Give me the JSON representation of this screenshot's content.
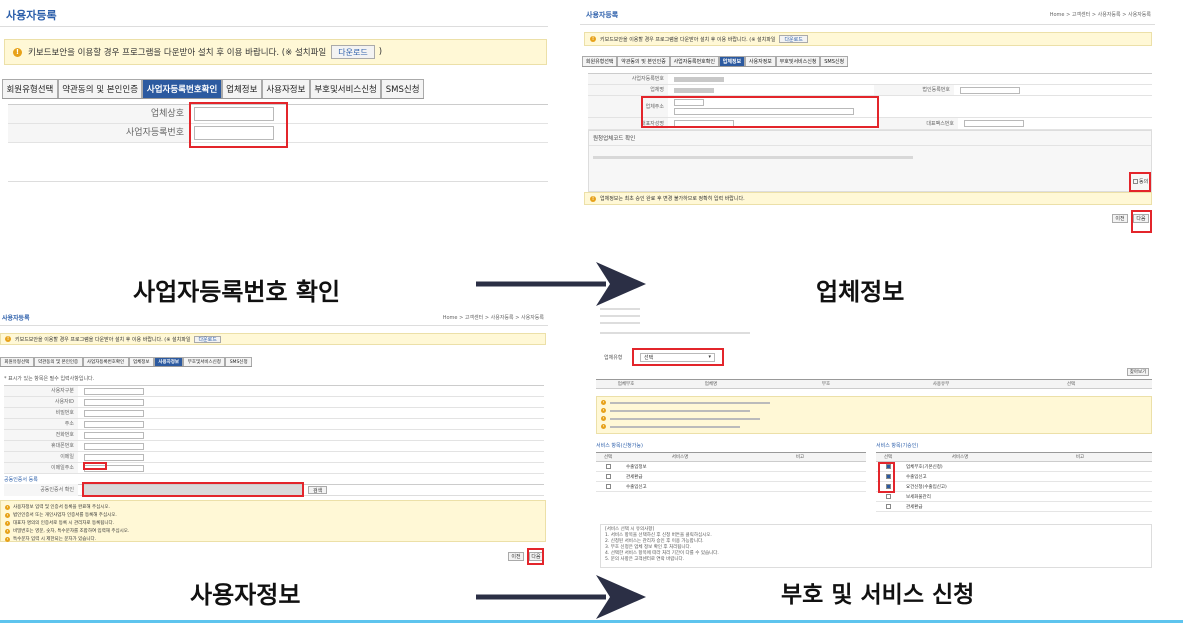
{
  "panel1": {
    "title": "사용자등록",
    "notice_text": "키보드보안을 이용할 경우 프로그램을 다운받아 설치 후 이용 바랍니다. (※ 설치파일",
    "download_label": "다운로드",
    "notice_close": ")",
    "tabs": [
      "회원유형선택",
      "약관동의 및 본인인증",
      "사업자등록번호확인",
      "업체정보",
      "사용자정보",
      "부호및서비스신청",
      "SMS신청"
    ],
    "active_tab": 2,
    "fields": [
      "업체상호",
      "사업자등록번호"
    ]
  },
  "panel2": {
    "title": "사용자등록",
    "breadcrumb": "Home > 고객센터 > 사용자등록 > 사용자등록",
    "notice_text": "키보드보안을 이용할 경우 프로그램을 다운받아 설치 후 이용 바랍니다. (※ 설치파일",
    "download_label": "다운로드",
    "tabs": [
      "회원유형선택",
      "약관동의 및 본인인증",
      "사업자등록번호확인",
      "업체정보",
      "사용자정보",
      "부호및서비스신청",
      "SMS신청"
    ],
    "active_tab": 3,
    "section_label": "원청업체코드 확인",
    "left_labels": [
      "사업자등록번호",
      "업체명",
      "업체주소",
      "대표자성명"
    ],
    "right_labels": [
      "법인등록번호",
      "대표팩스번호"
    ],
    "agree_label": "동의",
    "footer_notice": "업체정보는 최초 승인 완료 후 변경 불가하므로 정확히 입력 바랍니다.",
    "prev_label": "이전",
    "next_label": "다음"
  },
  "panel3": {
    "title": "사용자등록",
    "breadcrumb": "Home > 고객센터 > 사용자등록 > 사용자등록",
    "notice_text": "키보드보안을 이용할 경우 프로그램을 다운받아 설치 후 이용 바랍니다. (※ 설치파일",
    "download_label": "다운로드",
    "tabs": [
      "회원유형선택",
      "약관동의 및 본인인증",
      "사업자등록번호확인",
      "업체정보",
      "사용자정보",
      "부호및서비스신청",
      "SMS신청"
    ],
    "active_tab": 4,
    "required_note": "* 표시가 있는 항목은 필수 입력사항입니다.",
    "labels": [
      "사용자구분",
      "사용자ID",
      "비밀번호",
      "주소",
      "전화번호",
      "휴대폰번호",
      "이메일",
      "이메일주소"
    ],
    "cert_title": "공동인증서 등록",
    "cert_label": "공동인증서 확인",
    "search_label": "검색",
    "prev_label": "이전",
    "next_label": "다음",
    "notes": [
      "사용자정보 입력 및 인증서 등록을 완료해 주십시오.",
      "법인인증서 또는 개인사업자 인증서를 등록해 주십시오.",
      "대표자 명의의 인증서로 등록 시 관리자로 등록됩니다.",
      "비밀번호는 영문, 숫자, 특수문자를 조합하여 입력해 주십시오.",
      "특수문자 입력 시 제한되는 문자가 있습니다."
    ]
  },
  "panel4": {
    "trade_label": "업체유형",
    "trade_value": "선택",
    "search_btn": "찾아보기",
    "table_headers": [
      "업체부호",
      "업체명",
      "부호",
      "사용유무",
      "선택"
    ],
    "service_left_title": "서비스 항목(신청가능)",
    "service_right_title": "서비스 항목(기승인)",
    "service_headers": [
      "선택",
      "서비스명",
      "비고"
    ],
    "left_services": [
      "수출입정보",
      "관세환급",
      "수출입신고"
    ],
    "right_services": [
      "업체부호(기본신청)",
      "수출입신고",
      "요건신청(수출입신고)",
      "보세화물관리",
      "관세환급"
    ],
    "right_checked": [
      true,
      true,
      true,
      false,
      false
    ],
    "notes_title": "[서비스 선택 시 유의사항]",
    "notes": [
      "서비스 항목을 선택하신 후 신청 버튼을 클릭하십시오.",
      "신청된 서비스는 관리자 승인 후 이용 가능합니다.",
      "부호 신청은 업체 정보 확인 후 처리됩니다.",
      "선택한 서비스 항목에 따라 처리 기간이 다를 수 있습니다.",
      "문의 사항은 고객센터로 연락 바랍니다."
    ]
  },
  "captions": {
    "top_left": "사업자등록번호 확인",
    "top_right": "업체정보",
    "bottom_left": "사용자정보",
    "bottom_right": "부호 및 서비스 신청"
  },
  "colors": {
    "accent": "#2c5aa0",
    "highlight": "#e3252b",
    "notice_bg": "#fff8d6",
    "arrow": "#2b2f45",
    "bottom_rule": "#5ec4ee"
  }
}
